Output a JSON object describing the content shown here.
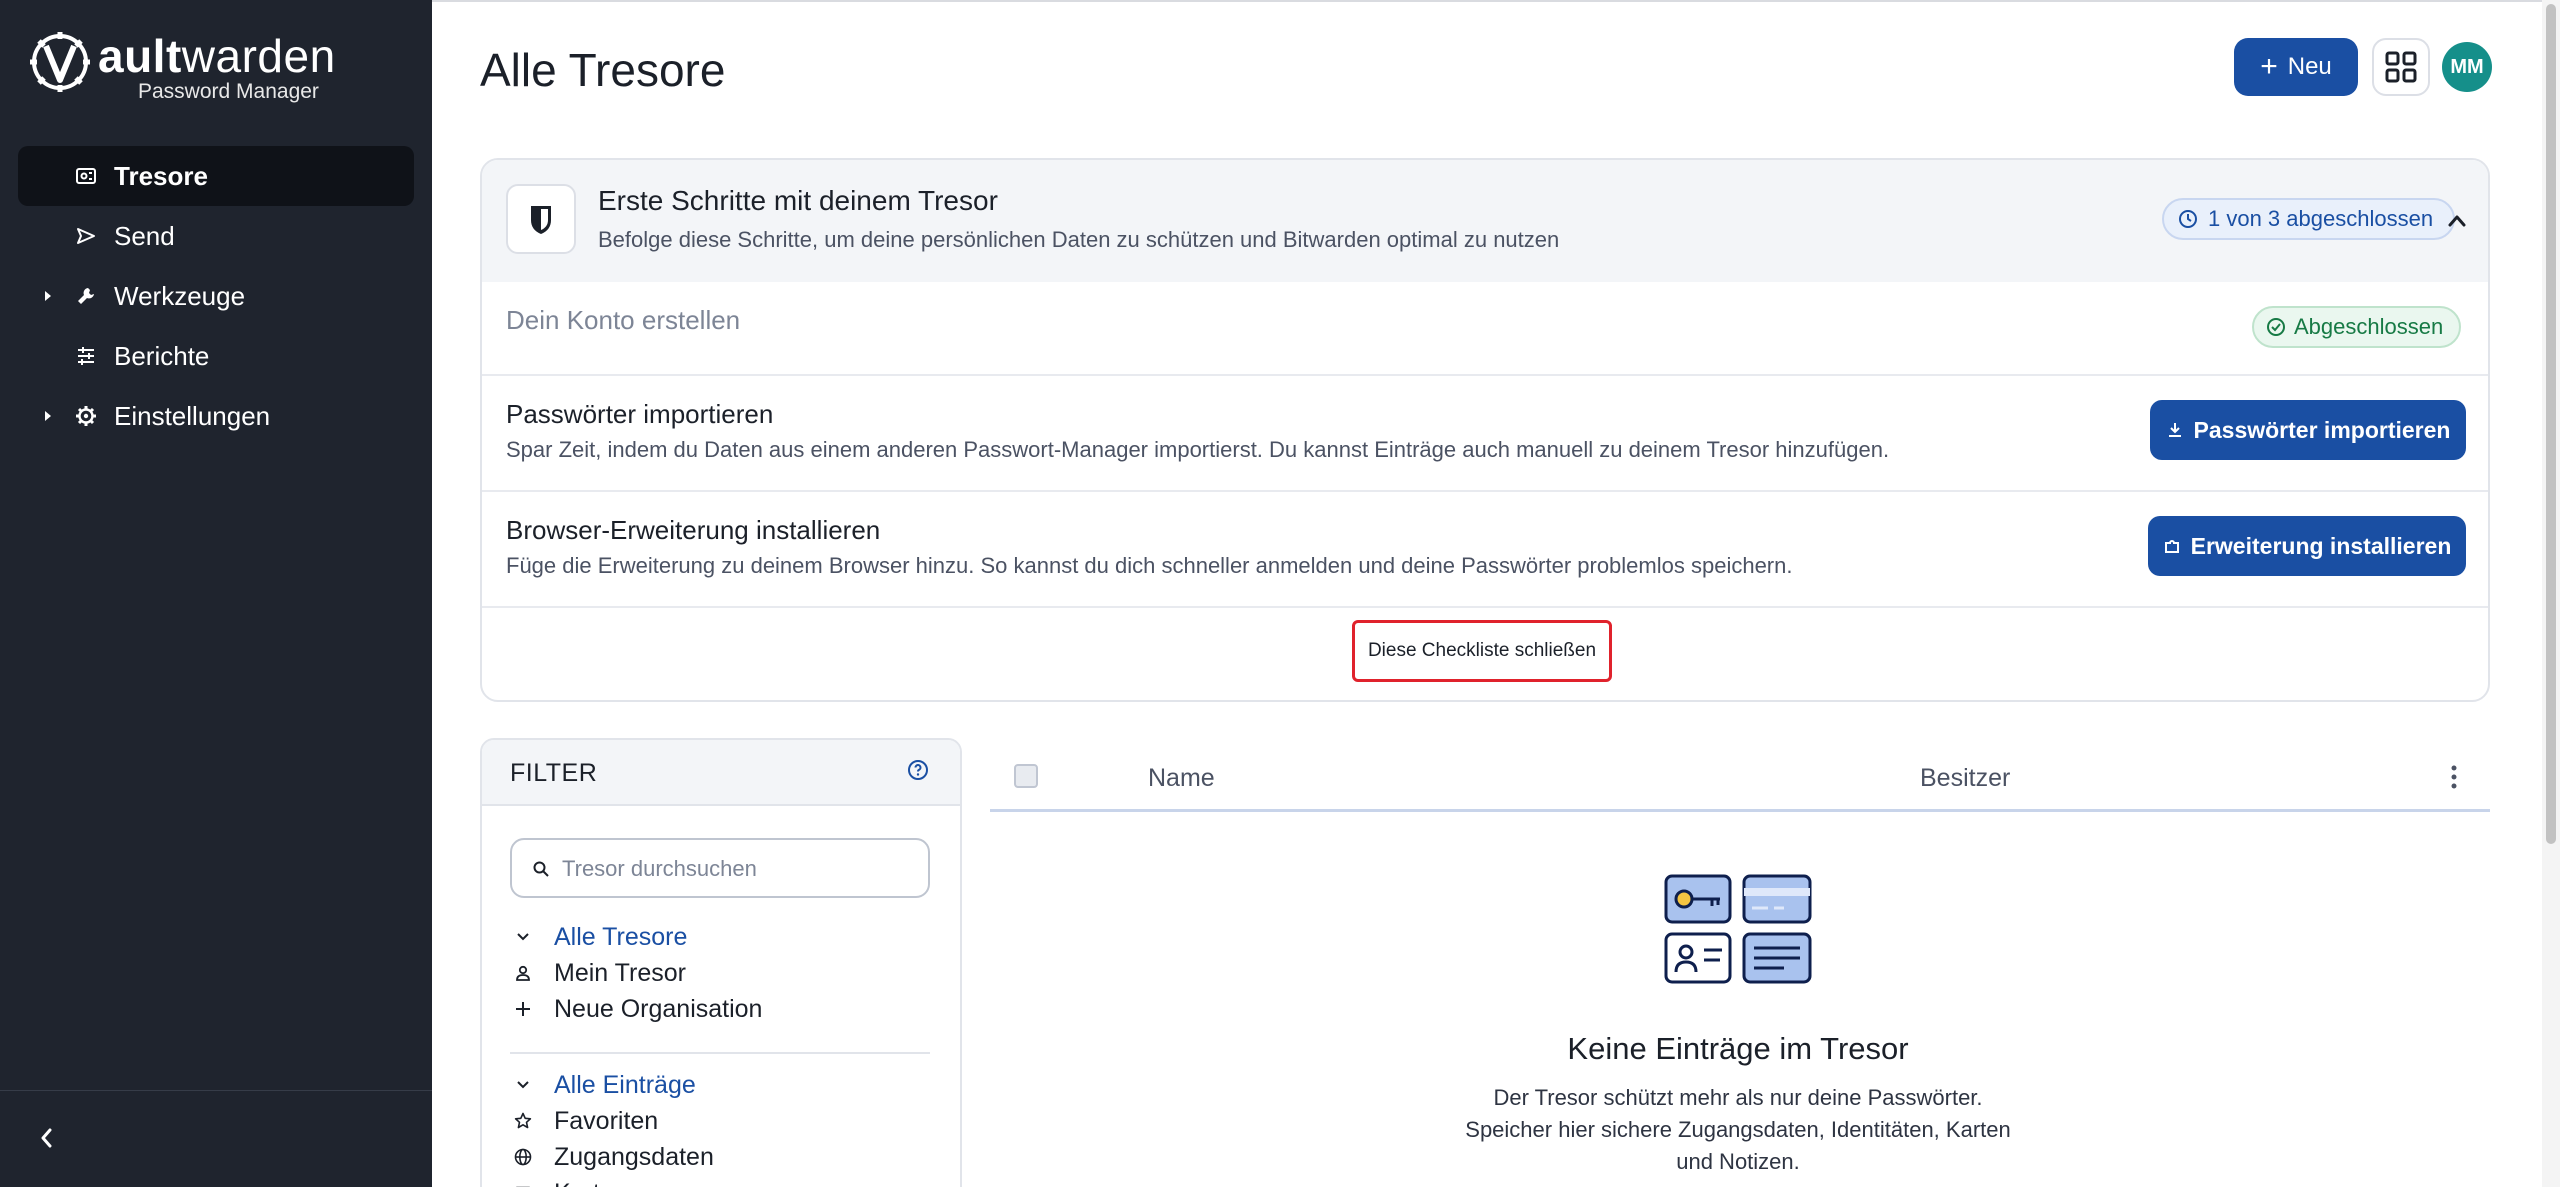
{
  "brand": {
    "name_bold": "ault",
    "name_rest": "warden",
    "subtitle": "Password Manager"
  },
  "sidebar": {
    "items": [
      {
        "label": "Tresore",
        "icon": "vault-icon",
        "active": true
      },
      {
        "label": "Send",
        "icon": "send-icon"
      },
      {
        "label": "Werkzeuge",
        "icon": "wrench-icon",
        "expandable": true
      },
      {
        "label": "Berichte",
        "icon": "sliders-icon"
      },
      {
        "label": "Einstellungen",
        "icon": "gear-icon",
        "expandable": true
      }
    ],
    "collapse_icon": "chevron-left-icon"
  },
  "header": {
    "title": "Alle Tresore",
    "new_button": "Neu",
    "avatar_initials": "MM"
  },
  "checklist": {
    "title": "Erste Schritte mit deinem Tresor",
    "subtitle": "Befolge diese Schritte, um deine persönlichen Daten zu schützen und Bitwarden optimal zu nutzen",
    "progress": "1 von 3 abgeschlossen",
    "steps": [
      {
        "title": "Dein Konto erstellen",
        "status": "Abgeschlossen"
      },
      {
        "title": "Passwörter importieren",
        "description": "Spar Zeit, indem du Daten aus einem anderen Passwort-Manager importierst. Du kannst Einträge auch manuell zu deinem Tresor hinzufügen.",
        "button": "Passwörter importieren"
      },
      {
        "title": "Browser-Erweiterung installieren",
        "description": "Füge die Erweiterung zu deinem Browser hinzu. So kannst du dich schneller anmelden und deine Passwörter problemlos speichern.",
        "button": "Erweiterung installieren"
      }
    ],
    "dismiss": "Diese Checkliste schließen"
  },
  "filter": {
    "title": "FILTER",
    "search_placeholder": "Tresor durchsuchen",
    "vaults": [
      "Alle Tresore",
      "Mein Tresor",
      "Neue Organisation"
    ],
    "types": [
      "Alle Einträge",
      "Favoriten",
      "Zugangsdaten",
      "Karten"
    ]
  },
  "table": {
    "columns": [
      "Name",
      "Besitzer"
    ]
  },
  "empty": {
    "title": "Keine Einträge im Tresor",
    "line1": "Der Tresor schützt mehr als nur deine Passwörter.",
    "line2": "Speicher hier sichere Zugangsdaten, Identitäten, Karten",
    "line3": "und Notizen."
  },
  "colors": {
    "sidebar": "#1f242e",
    "primary": "#1a4fa3",
    "success": "#177a45",
    "avatar": "#158f8a"
  }
}
